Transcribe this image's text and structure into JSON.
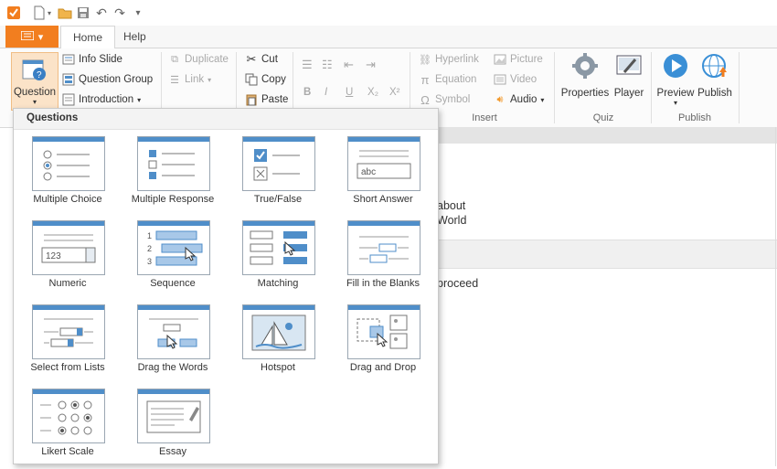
{
  "ribbon": {
    "tabs": [
      "Home",
      "Help"
    ],
    "question_button": "Question",
    "slides": [
      "Info Slide",
      "Question Group",
      "Introduction"
    ],
    "clipboard": [
      "Duplicate",
      "Link",
      "Cut",
      "Copy",
      "Paste"
    ],
    "format": [
      "B",
      "I",
      "U",
      "X₂",
      "X²"
    ],
    "insert_left": [
      "Hyperlink",
      "Equation",
      "Symbol"
    ],
    "insert_right": [
      "Picture",
      "Video",
      "Audio"
    ],
    "groups": {
      "insert": "Insert",
      "quiz": "Quiz",
      "publish": "Publish"
    },
    "quiz_buttons": [
      "Properties",
      "Player"
    ],
    "publish_buttons": [
      "Preview",
      "Publish"
    ]
  },
  "dropdown": {
    "header": "Questions",
    "items": [
      "Multiple Choice",
      "Multiple Response",
      "True/False",
      "Short Answer",
      "Numeric",
      "Sequence",
      "Matching",
      "Fill in the Blanks",
      "Select from Lists",
      "Drag the Words",
      "Hotspot",
      "Drag and Drop",
      "Likert Scale",
      "Essay"
    ],
    "thumb_text": {
      "short_answer": "abc",
      "numeric": "123",
      "sequence": [
        "1",
        "2",
        "3"
      ]
    }
  },
  "document": {
    "line1": "about",
    "line2": "World",
    "line3": "proceed"
  },
  "colors": {
    "accent": "#f27e1f",
    "thumb_blue": "#4f8ec9",
    "publish_blue": "#3a8fd6"
  }
}
